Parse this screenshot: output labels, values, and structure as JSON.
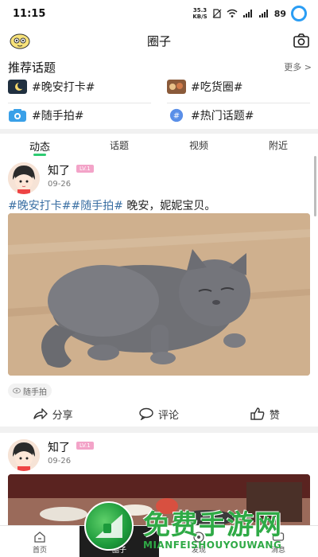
{
  "status_bar": {
    "time": "11:15",
    "network_speed_top": "35.3",
    "network_speed_unit": "KB/S",
    "battery": "89"
  },
  "header": {
    "title": "圈子"
  },
  "topics": {
    "heading": "推荐话题",
    "more_label": "更多 >",
    "items": [
      {
        "label": "#晚安打卡#",
        "icon": "moon-thumbnail"
      },
      {
        "label": "#吃货圈#",
        "icon": "food-thumbnail"
      },
      {
        "label": "#随手拍#",
        "icon": "camera-badge"
      },
      {
        "label": "#热门话题#",
        "icon": "hashtag-badge"
      }
    ]
  },
  "tabs": [
    {
      "label": "动态",
      "active": true
    },
    {
      "label": "话题",
      "active": false
    },
    {
      "label": "视频",
      "active": false
    },
    {
      "label": "附近",
      "active": false
    }
  ],
  "posts": [
    {
      "username": "知了",
      "level": "LV.1",
      "date": "09-26",
      "tags": [
        "#晚安打卡#",
        "#随手拍#"
      ],
      "text": " 晚安，妮妮宝贝。",
      "image": "gray-cat-photo",
      "topic_chip": "随手拍",
      "share_label": "分享",
      "comment_label": "评论",
      "like_label": "赞"
    },
    {
      "username": "知了",
      "level": "LV.1",
      "date": "09-26",
      "image": "restaurant-photo"
    }
  ],
  "bottom_nav": [
    {
      "label": "首页",
      "icon": "home-icon",
      "active": false
    },
    {
      "label": "圈子",
      "icon": "circle-icon",
      "active": true
    },
    {
      "label": "发现",
      "icon": "discover-icon",
      "active": false
    },
    {
      "label": "消息",
      "icon": "message-icon",
      "active": false
    }
  ],
  "watermark": {
    "title": "免费手游网",
    "subtitle": "MIANFEISHOUYOUWANG"
  },
  "colors": {
    "accent_green": "#2ecb71",
    "tag_blue": "#3a6fa3",
    "level_pink": "#f3a3c8",
    "battery_blue": "#2a9df4",
    "watermark_green": "#2faa46"
  }
}
